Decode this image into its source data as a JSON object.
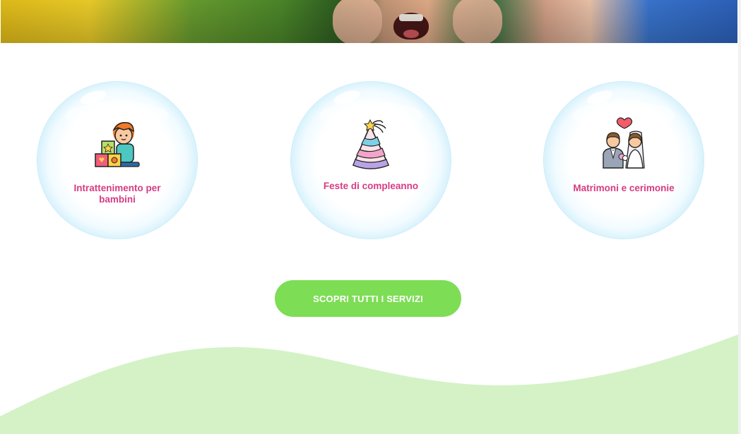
{
  "hero": {
    "image_alt": "Bambini sorridenti sull'erba"
  },
  "services": [
    {
      "title": "Intrattenimento per bambini",
      "icon": "child-with-toy-blocks-icon"
    },
    {
      "title": "Feste di compleanno",
      "icon": "party-hat-icon"
    },
    {
      "title": "Matrimoni e cerimonie",
      "icon": "wedding-couple-icon"
    }
  ],
  "cta": {
    "label": "SCOPRI TUTTI I SERVIZI"
  },
  "colors": {
    "accent_pink": "#d63b84",
    "cta_green": "#7ddd55",
    "wave_green": "#d4f2c6",
    "bubble_blue": "#69c8ee"
  }
}
